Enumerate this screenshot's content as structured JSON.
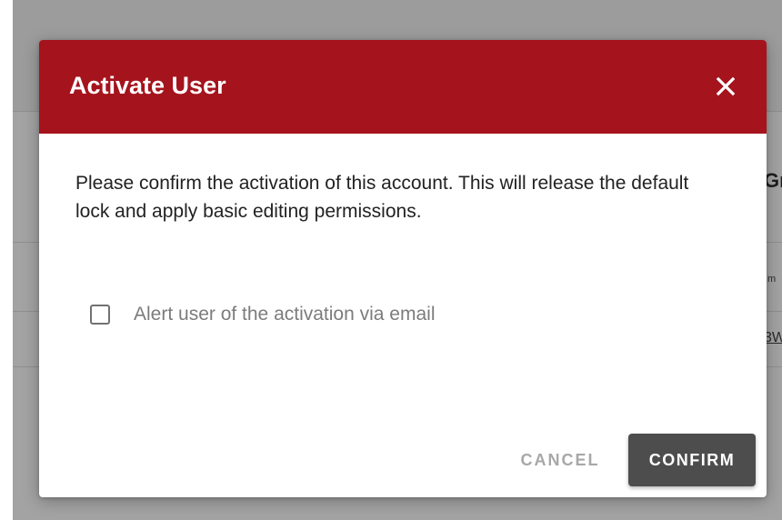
{
  "background_page": {
    "heading_fragment": "Gr",
    "small_fragment": "m",
    "link_fragment": "3W"
  },
  "dialog": {
    "title": "Activate User",
    "close_icon": "close-icon",
    "message": "Please confirm the activation of this account. This will release the default lock and apply basic editing permissions.",
    "checkbox": {
      "label": "Alert user of the activation via email",
      "checked": false
    },
    "buttons": {
      "cancel": "CANCEL",
      "confirm": "CONFIRM"
    }
  },
  "colors": {
    "header": "#a5131d",
    "confirm_button": "#4d4d4d",
    "backdrop": "#a3a3a3"
  }
}
